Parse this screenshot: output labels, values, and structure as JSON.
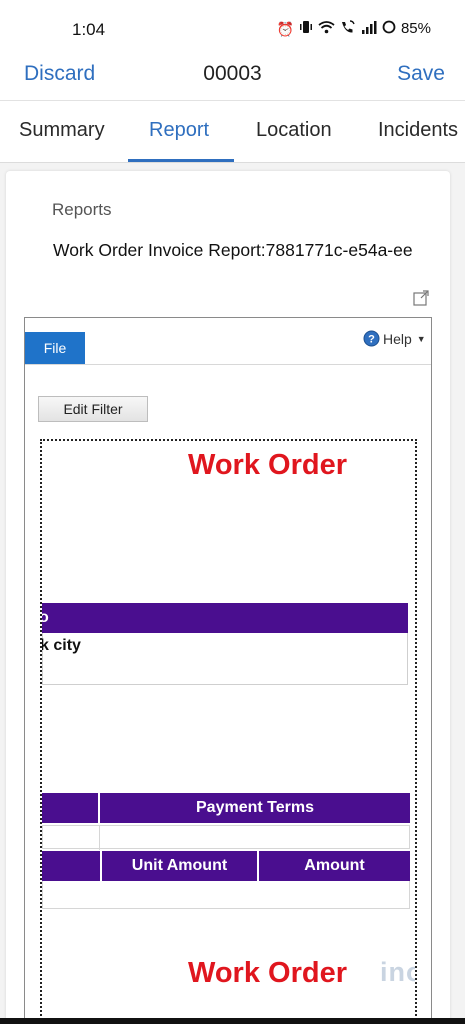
{
  "status_bar": {
    "time": "1:04",
    "battery": "85%",
    "icons": [
      "alarm-icon",
      "vibrate-icon",
      "wifi-icon",
      "wifi-calling-icon",
      "signal-icon",
      "battery-icon"
    ]
  },
  "header": {
    "discard_label": "Discard",
    "title": "00003",
    "save_label": "Save",
    "accent_color": "#2f6fbf"
  },
  "tabs": [
    {
      "label": "Summary",
      "active": false
    },
    {
      "label": "Report",
      "active": true
    },
    {
      "label": "Location",
      "active": false
    },
    {
      "label": "Incidents",
      "active": false
    }
  ],
  "report_panel": {
    "section_label": "Reports",
    "report_name": "Work Order Invoice Report:7881771c-e54a-ee"
  },
  "viewer": {
    "file_tab": "File",
    "help_label": "Help",
    "edit_filter_label": "Edit Filter",
    "report_title": "Work Order",
    "header_band_text": "o",
    "city_text": "k city",
    "payment_terms_header": "Payment Terms",
    "unit_amount_header": "Unit Amount",
    "amount_header": "Amount",
    "report_title_2": "Work Order",
    "watermark": "inogic",
    "title_color": "#e0161e",
    "band_color": "#4a0e8f"
  }
}
